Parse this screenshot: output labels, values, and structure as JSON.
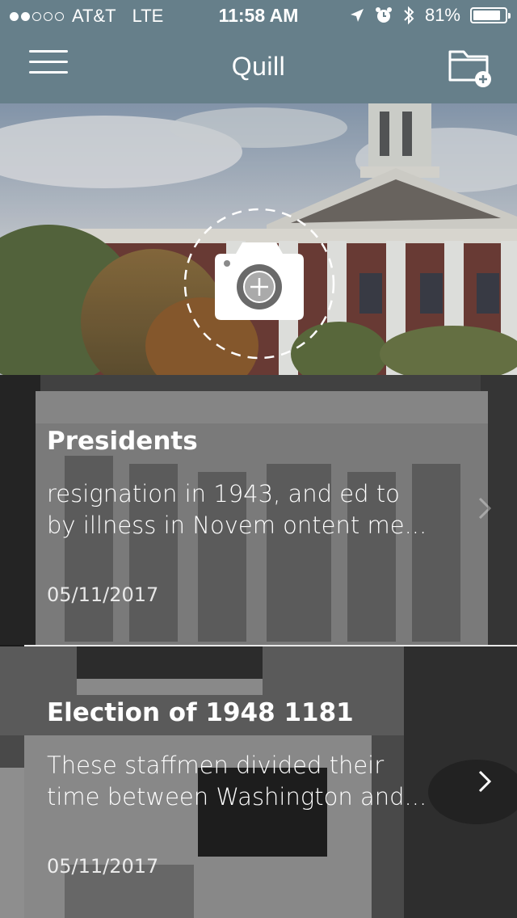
{
  "status_bar": {
    "carrier": "AT&T",
    "network": "LTE",
    "time": "11:58 AM",
    "battery_percent_label": "81%",
    "battery_level": 0.81,
    "signal_bars_filled": 2,
    "signal_bars_total": 5
  },
  "navbar": {
    "title": "Quill",
    "menu_icon": "hamburger-menu-icon",
    "folder_icon": "folder-add-icon"
  },
  "hero": {
    "action_icon": "camera-add-icon"
  },
  "notes": [
    {
      "title": "Presidents",
      "excerpt_line1": "resignation in 1943, and ed to",
      "excerpt_line2": "by illness in Novem ontent me...",
      "date": "05/11/2017"
    },
    {
      "title": "Election of 1948 1181",
      "excerpt_line1": "These staffmen divided their",
      "excerpt_line2": "time between Washington and...",
      "date": "05/11/2017"
    }
  ],
  "colors": {
    "header_bg": "#667f8a",
    "text": "#ffffff"
  }
}
